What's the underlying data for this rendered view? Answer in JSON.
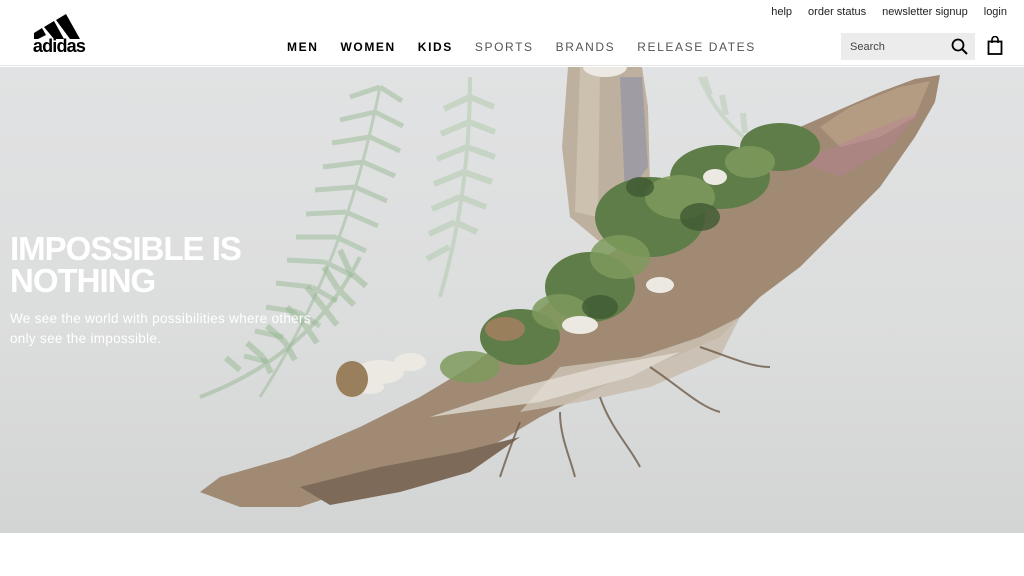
{
  "brand": {
    "name": "adidas"
  },
  "util_links": [
    "help",
    "order status",
    "newsletter signup",
    "login"
  ],
  "nav": {
    "primary": [
      "MEN",
      "WOMEN",
      "KIDS"
    ],
    "secondary": [
      "SPORTS",
      "BRANDS",
      "RELEASE DATES"
    ]
  },
  "search": {
    "placeholder": "Search",
    "value": ""
  },
  "hero": {
    "title": "IMPOSSIBLE IS NOTHING",
    "subtitle": "We see the world with possibilities where others only see the impossible."
  },
  "icons": {
    "search": "search-icon",
    "bag": "shopping-bag-icon",
    "logo": "adidas-three-stripes-logo"
  }
}
